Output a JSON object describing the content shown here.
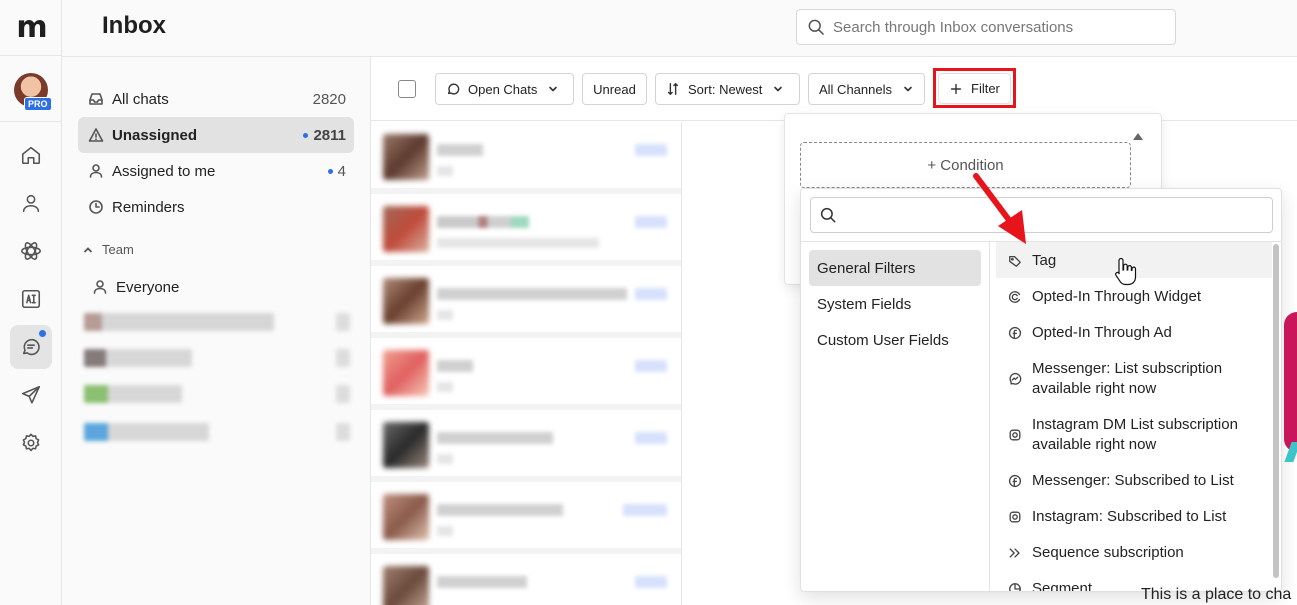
{
  "header": {
    "title": "Inbox",
    "search_placeholder": "Search through Inbox conversations"
  },
  "rail": {
    "logo": "m",
    "badge": "PRO"
  },
  "sidebar": {
    "items": [
      {
        "label": "All chats",
        "count": "2820"
      },
      {
        "label": "Unassigned",
        "count": "2811"
      },
      {
        "label": "Assigned to me",
        "count": "4"
      },
      {
        "label": "Reminders",
        "count": ""
      }
    ],
    "team_label": "Team",
    "team_items": [
      {
        "label": "Everyone"
      }
    ]
  },
  "toolbar": {
    "open_chats": "Open Chats",
    "unread": "Unread",
    "sort": "Sort: Newest",
    "channels": "All Channels",
    "filter": "Filter"
  },
  "filter_panel": {
    "condition": "+ Condition",
    "categories": [
      "General Filters",
      "System Fields",
      "Custom User Fields"
    ],
    "options": [
      {
        "label": "Tag",
        "icon": "tag-icon"
      },
      {
        "label": "Opted-In Through Widget",
        "icon": "widget-icon"
      },
      {
        "label": "Opted-In Through Ad",
        "icon": "facebook-icon"
      },
      {
        "label": "Messenger: List subscription available right now",
        "icon": "messenger-icon"
      },
      {
        "label": "Instagram DM List subscription available right now",
        "icon": "instagram-icon"
      },
      {
        "label": "Messenger: Subscribed to List",
        "icon": "facebook-icon"
      },
      {
        "label": "Instagram: Subscribed to List",
        "icon": "instagram-icon"
      },
      {
        "label": "Sequence subscription",
        "icon": "sequence-icon"
      },
      {
        "label": "Segment",
        "icon": "segment-icon"
      }
    ]
  },
  "main": {
    "partial_text": "This is a place to cha"
  },
  "colors": {
    "accent": "#2f6fe4",
    "highlight": "#e8141c",
    "active_bg": "#e2e2e2"
  }
}
